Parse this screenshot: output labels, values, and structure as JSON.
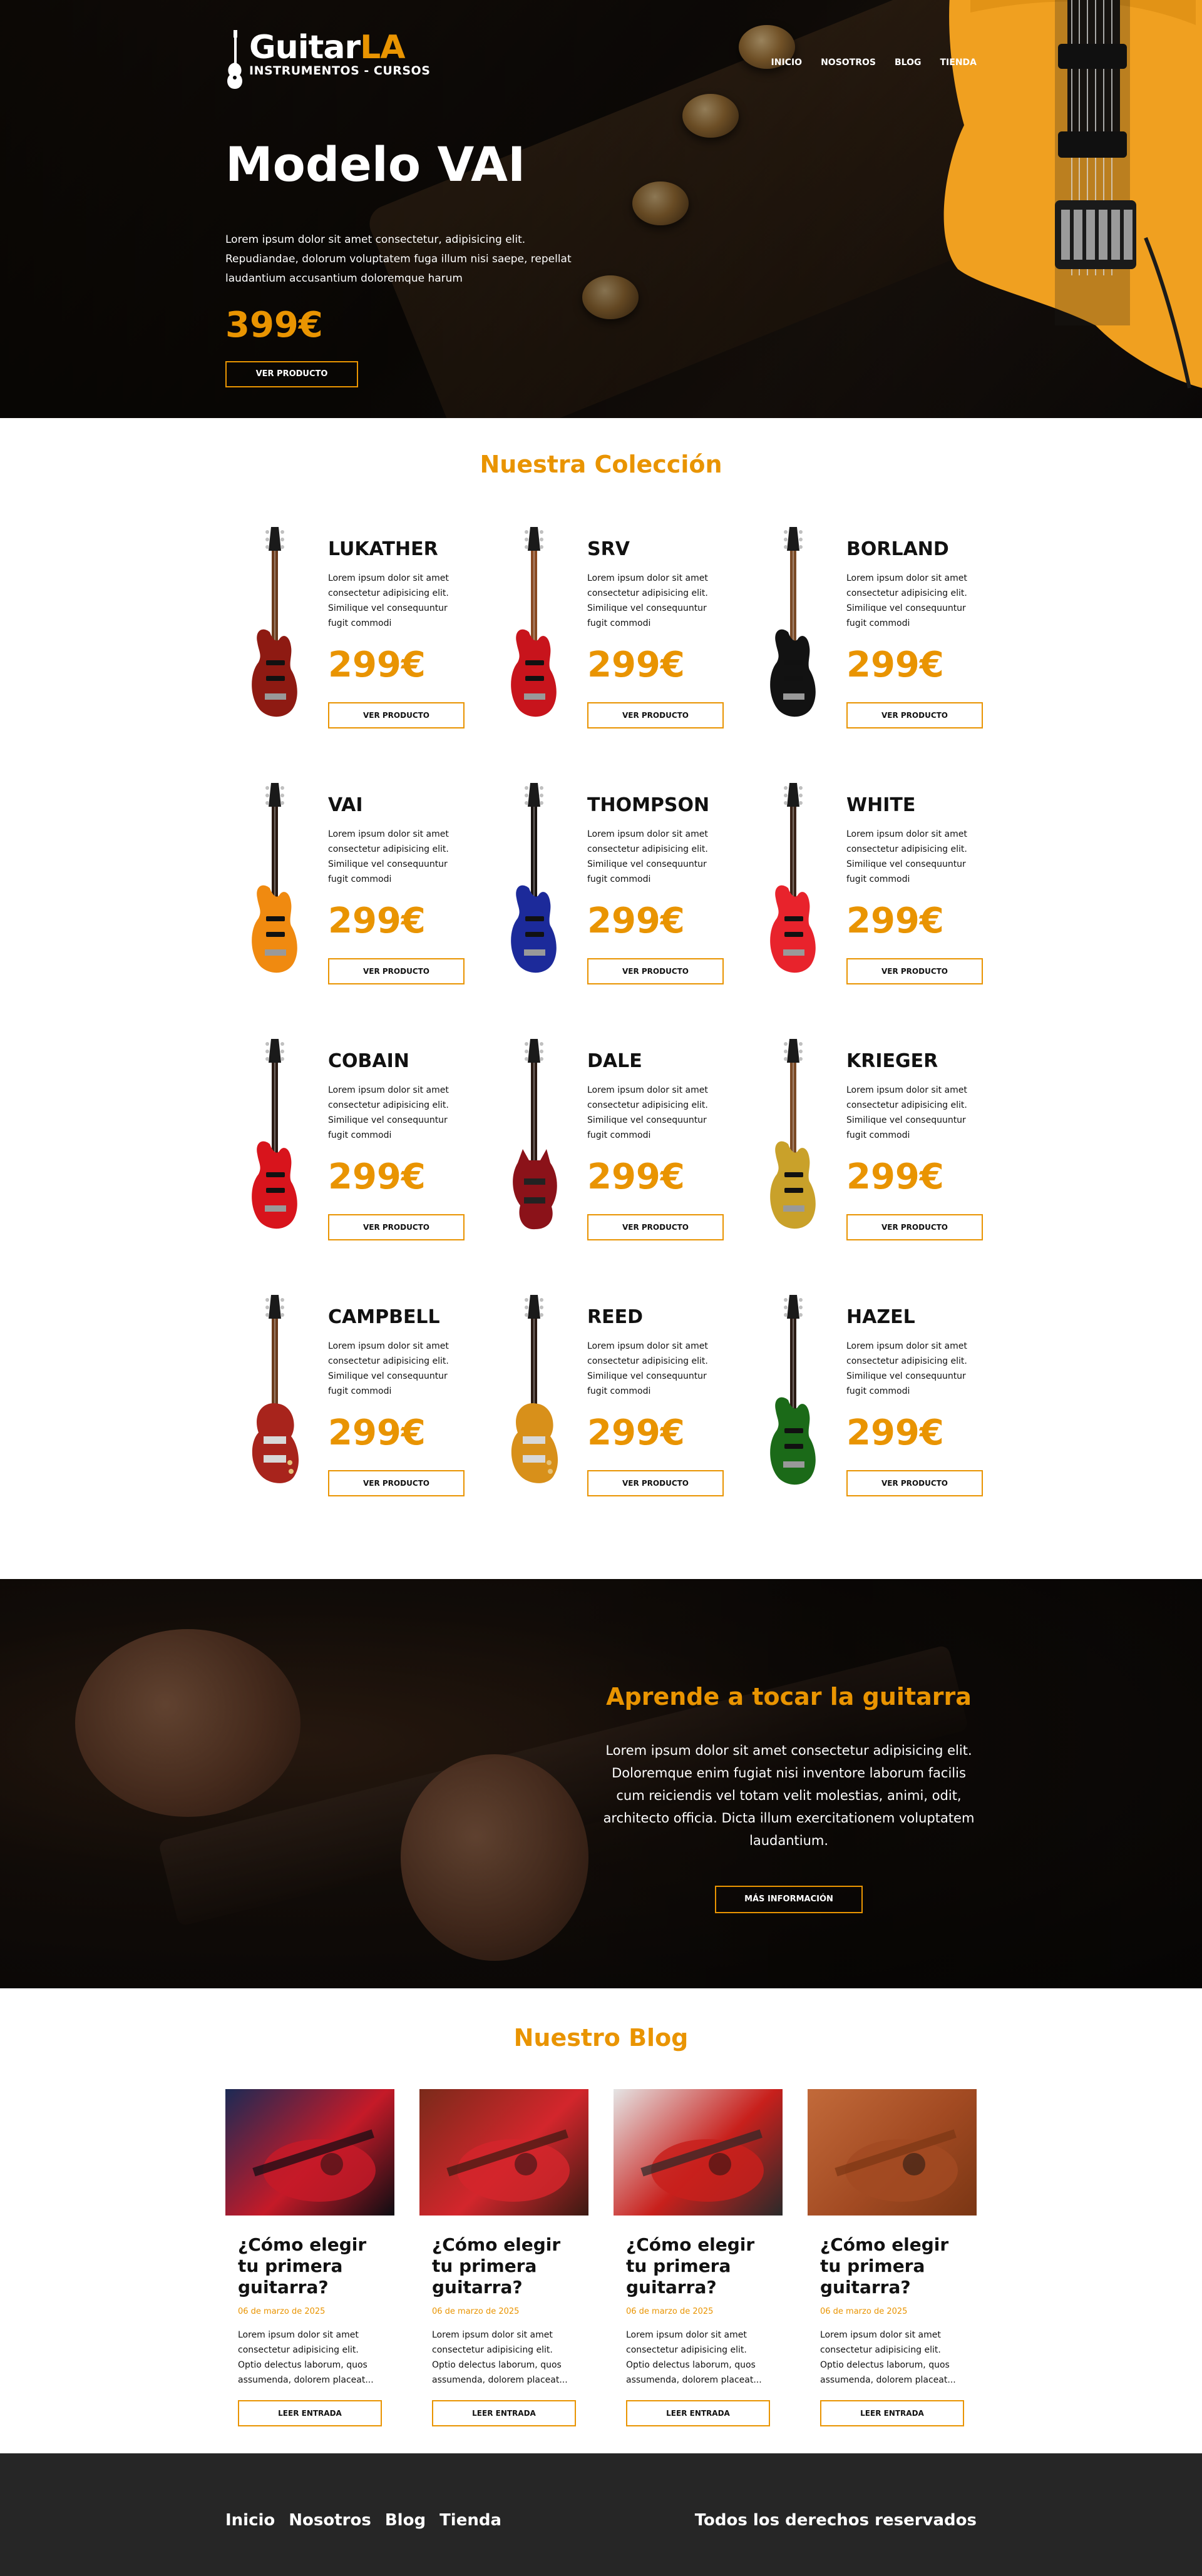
{
  "brand": {
    "name_main": "Guitar",
    "name_accent": "LA",
    "tagline": "INSTRUMENTOS - CURSOS"
  },
  "nav": [
    "Inicio",
    "Nosotros",
    "Blog",
    "Tienda"
  ],
  "nav_upper": [
    "INICIO",
    "NOSOTROS",
    "BLOG",
    "TIENDA"
  ],
  "hero": {
    "title": "Modelo VAI",
    "text": "Lorem ipsum dolor sit amet consectetur, adipisicing elit. Repudiandae, dolorum voluptatem fuga illum nisi saepe, repellat laudantium accusantium doloremque harum",
    "price": "399€",
    "button": "VER PRODUCTO"
  },
  "collection": {
    "title": "Nuestra Colección",
    "description": "Lorem ipsum dolor sit amet consectetur adipisicing elit. Similique vel consequuntur fugit commodi",
    "price": "299€",
    "button": "VER PRODUCTO",
    "items": [
      {
        "name": "LUKATHER",
        "body": "#8e1a12",
        "neck": "#6b3b1c",
        "shape": "strat"
      },
      {
        "name": "SRV",
        "body": "#c8141c",
        "neck": "#8a4a22",
        "shape": "strat"
      },
      {
        "name": "BORLAND",
        "body": "#121212",
        "neck": "#7a4a26",
        "shape": "strat"
      },
      {
        "name": "VAI",
        "body": "#f08a10",
        "neck": "#2a1a12",
        "shape": "strat"
      },
      {
        "name": "THOMPSON",
        "body": "#1c2a9a",
        "neck": "#1a1411",
        "shape": "strat"
      },
      {
        "name": "WHITE",
        "body": "#e8232c",
        "neck": "#3b2418",
        "shape": "strat"
      },
      {
        "name": "COBAIN",
        "body": "#d8141c",
        "neck": "#2b1b14",
        "shape": "strat"
      },
      {
        "name": "DALE",
        "body": "#8b1219",
        "neck": "#2b1b14",
        "shape": "sg"
      },
      {
        "name": "KRIEGER",
        "body": "#c9a12a",
        "neck": "#7b4a26",
        "shape": "strat"
      },
      {
        "name": "CAMPBELL",
        "body": "#a8241c",
        "neck": "#6b3b1c",
        "shape": "lp"
      },
      {
        "name": "REED",
        "body": "#d8901a",
        "neck": "#2b1b14",
        "shape": "lp"
      },
      {
        "name": "HAZEL",
        "body": "#1b6a18",
        "neck": "#2b1b14",
        "shape": "strat"
      }
    ]
  },
  "learn": {
    "title": "Aprende a tocar la guitarra",
    "text": "Lorem ipsum dolor sit amet consectetur adipisicing elit. Doloremque enim fugiat nisi inventore laborum facilis cum reiciendis vel totam velit molestias, animi, odit, architecto officia. Dicta illum exercitationem voluptatem laudantium.",
    "button": "MÁS INFORMACIÓN"
  },
  "blog": {
    "title": "Nuestro Blog",
    "posts": [
      {
        "title": "¿Cómo elegir tu primera guitarra?",
        "date": "06 de marzo de 2025",
        "text": "Lorem ipsum dolor sit amet consectetur adipisicing elit. Optio delectus laborum, quos assumenda, dolorem placeat...",
        "button": "LEER ENTRADA",
        "palette": [
          "#1b2a55",
          "#c51a28",
          "#0d0d12"
        ]
      },
      {
        "title": "¿Cómo elegir tu primera guitarra?",
        "date": "06 de marzo de 2025",
        "text": "Lorem ipsum dolor sit amet consectetur adipisicing elit. Optio delectus laborum, quos assumenda, dolorem placeat...",
        "button": "LEER ENTRADA",
        "palette": [
          "#7a2a1a",
          "#d3262c",
          "#3a1a12"
        ]
      },
      {
        "title": "¿Cómo elegir tu primera guitarra?",
        "date": "06 de marzo de 2025",
        "text": "Lorem ipsum dolor sit amet consectetur adipisicing elit. Optio delectus laborum, quos assumenda, dolorem placeat...",
        "button": "LEER ENTRADA",
        "palette": [
          "#e5e5e5",
          "#c8201c",
          "#2a2a2a"
        ]
      },
      {
        "title": "¿Cómo elegir tu primera guitarra?",
        "date": "06 de marzo de 2025",
        "text": "Lorem ipsum dolor sit amet consectetur adipisicing elit. Optio delectus laborum, quos assumenda, dolorem placeat...",
        "button": "LEER ENTRADA",
        "palette": [
          "#c26a3a",
          "#a24a22",
          "#7a3614"
        ]
      }
    ]
  },
  "footer": {
    "copyright": "Todos los derechos reservados"
  },
  "colors": {
    "accent": "#e99401",
    "footer_bg": "#262626",
    "text": "#111111"
  }
}
